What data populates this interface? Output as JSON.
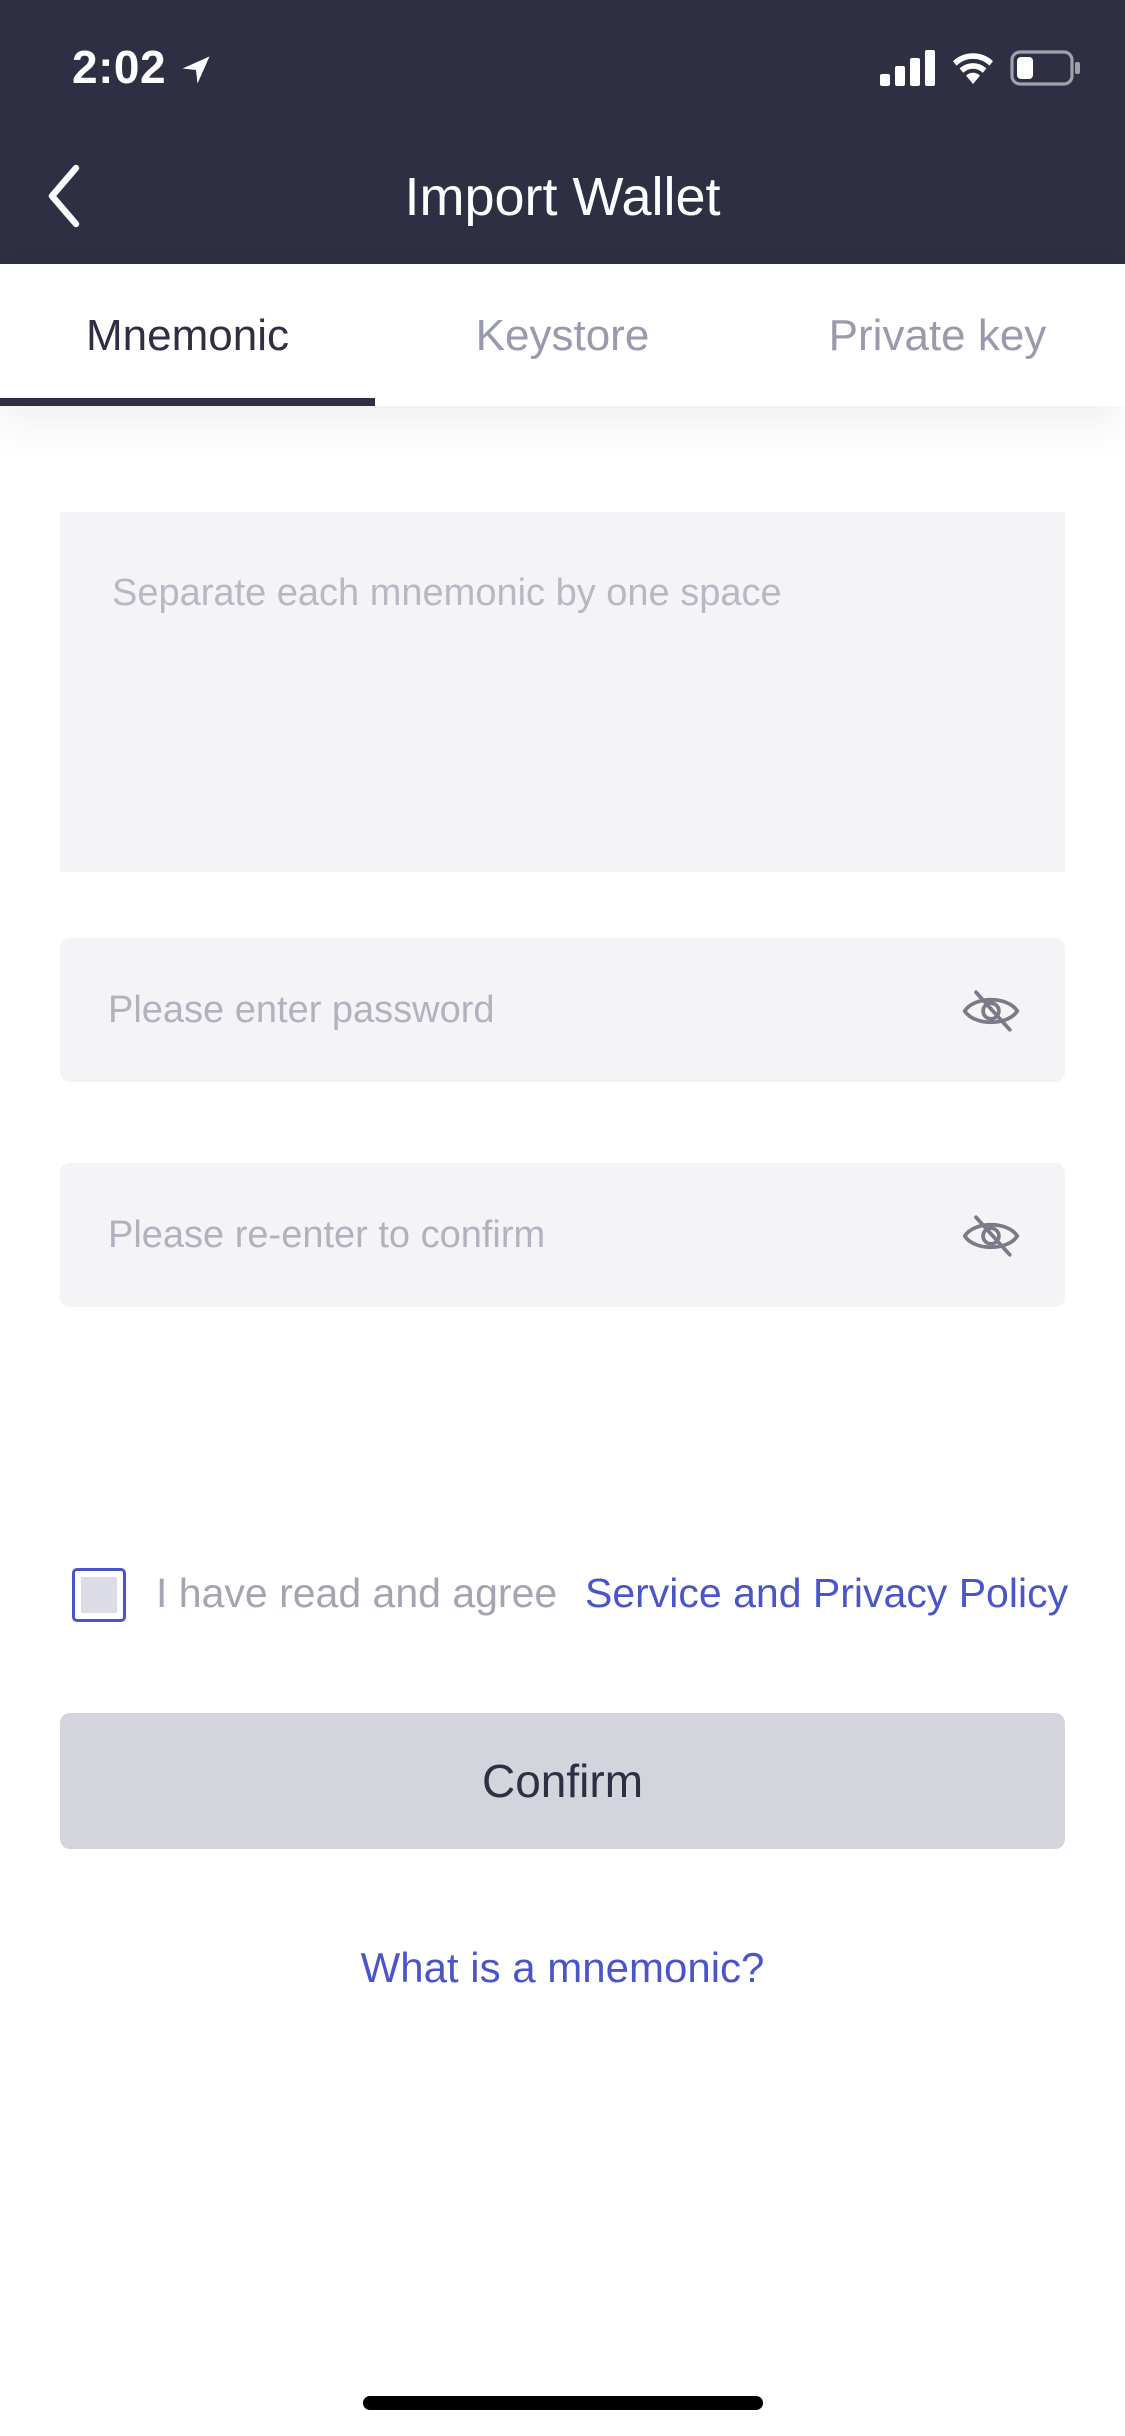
{
  "status_bar": {
    "time": "2:02"
  },
  "nav": {
    "title": "Import Wallet"
  },
  "tabs": [
    {
      "label": "Mnemonic",
      "active": true
    },
    {
      "label": "Keystore",
      "active": false
    },
    {
      "label": "Private key",
      "active": false
    }
  ],
  "form": {
    "mnemonic_placeholder": "Separate each mnemonic by one space",
    "password_placeholder": "Please enter password",
    "confirm_placeholder": "Please re-enter to confirm"
  },
  "agreement": {
    "text": "I have read and agree",
    "link": "Service and Privacy Policy",
    "checked": false
  },
  "confirm_label": "Confirm",
  "help_link": "What is a mnemonic?",
  "colors": {
    "header_bg": "#2f2f44",
    "accent": "#4a55c9",
    "field_bg": "#f4f4f6",
    "button_disabled": "#d4d4dc"
  },
  "icons": {
    "back": "chevron-left-icon",
    "location": "location-arrow-icon",
    "signal": "cellular-signal-icon",
    "wifi": "wifi-icon",
    "battery": "battery-icon",
    "eye": "eye-slash-icon"
  }
}
